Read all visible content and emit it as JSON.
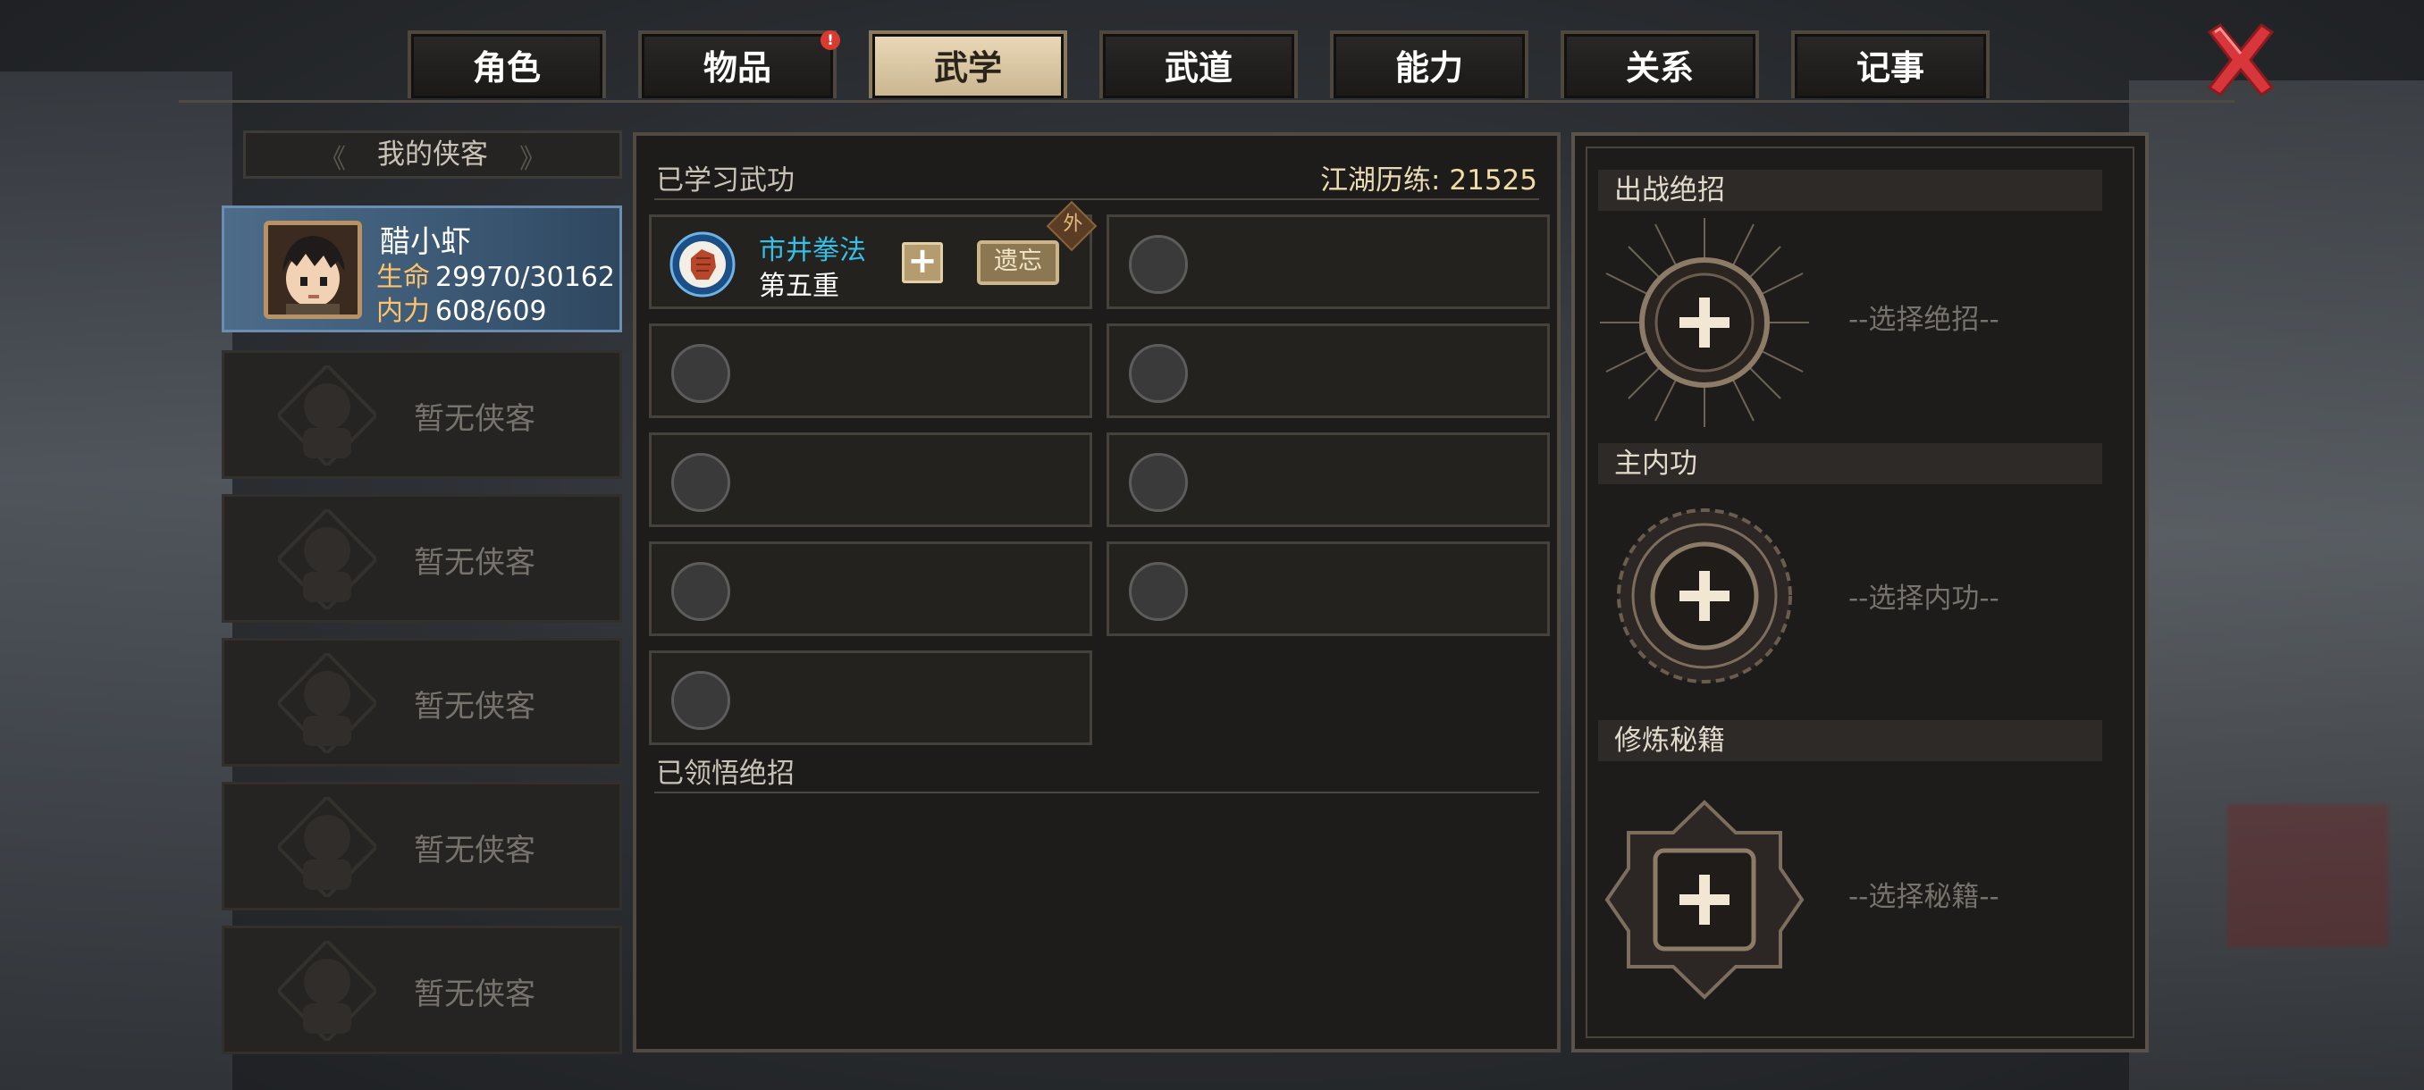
{
  "tabs": [
    {
      "label": "角色",
      "active": false,
      "badge": false
    },
    {
      "label": "物品",
      "active": false,
      "badge": true,
      "badge_text": "!"
    },
    {
      "label": "武学",
      "active": true,
      "badge": false
    },
    {
      "label": "武道",
      "active": false,
      "badge": false
    },
    {
      "label": "能力",
      "active": false,
      "badge": false
    },
    {
      "label": "关系",
      "active": false,
      "badge": false
    },
    {
      "label": "记事",
      "active": false,
      "badge": false
    }
  ],
  "close_icon": "close-x-icon",
  "roster": {
    "title": "我的侠客",
    "hero": {
      "name": "醋小虾",
      "hp_label": "生命",
      "hp": "29970/30162",
      "mp_label": "内力",
      "mp": "608/609"
    },
    "empty_slots": [
      "暂无侠客",
      "暂无侠客",
      "暂无侠客",
      "暂无侠客",
      "暂无侠客"
    ]
  },
  "martial": {
    "learned_title": "已学习武功",
    "exp_label": "江湖历练:",
    "exp_value": "21525",
    "skill": {
      "name": "市井拳法",
      "level": "第五重",
      "plus": "+",
      "forget": "遗忘",
      "type_tag": "外"
    },
    "ultimates_title": "已领悟绝招"
  },
  "right": {
    "battle_title": "出战绝招",
    "battle_placeholder": "--选择绝招--",
    "inner_title": "主内功",
    "inner_placeholder": "--选择内功--",
    "book_title": "修炼秘籍",
    "book_placeholder": "--选择秘籍--",
    "plus": "+"
  },
  "colors": {
    "active_tab": "#ead9b8",
    "skill_name": "#36c0e6",
    "stat_label": "#ffc46a",
    "close": "#d8363a"
  }
}
